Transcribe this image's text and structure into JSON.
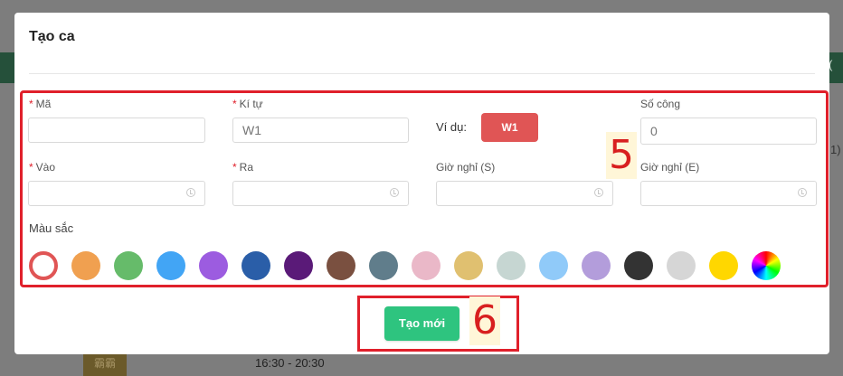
{
  "background": {
    "right_text_1": "(",
    "right_text_2": "1)",
    "tag": "霸霸",
    "time": "16:30 - 20:30"
  },
  "modal": {
    "title": "Tạo ca",
    "fields": {
      "ma": {
        "label": "Mã",
        "required_mark": "*",
        "value": ""
      },
      "ki_tu": {
        "label": "Kí tự",
        "required_mark": "*",
        "placeholder": "W1"
      },
      "vi_du": {
        "label": "Ví dụ:",
        "badge": "W1",
        "badge_color": "#e05555"
      },
      "so_cong": {
        "label": "Số công",
        "placeholder": "0"
      },
      "vao": {
        "label": "Vào",
        "required_mark": "*"
      },
      "ra": {
        "label": "Ra",
        "required_mark": "*"
      },
      "gio_nghi_s": {
        "label": "Giờ nghỉ (S)"
      },
      "gio_nghi_e": {
        "label": "Giờ nghỉ (E)"
      }
    },
    "color_section": {
      "label": "Màu sắc",
      "selected_index": 0,
      "colors": [
        "#e05555",
        "#f0a050",
        "#66bb6a",
        "#42a5f5",
        "#9c5ce0",
        "#2a5ea8",
        "#5a1a78",
        "#7a5040",
        "#607d8b",
        "#eab8c8",
        "#e0c070",
        "#c6d6d2",
        "#90caf9",
        "#b39ddb",
        "#333333",
        "#d6d6d6",
        "#ffd700",
        "rainbow"
      ]
    },
    "create_button": "Tạo mới",
    "annotations": {
      "box_5": "5",
      "box_6": "6"
    }
  }
}
